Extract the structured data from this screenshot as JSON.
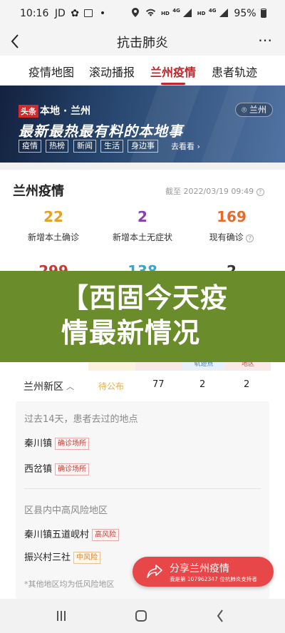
{
  "status_bar": {
    "time": "10:16",
    "carrier": "JD",
    "battery": "95%",
    "icons": [
      "paw-icon",
      "image-icon",
      "dot-icon",
      "location-icon",
      "wifi-icon",
      "signal-icon",
      "battery-icon"
    ],
    "hd1": "HD",
    "net1": "4G",
    "hd2": "HD",
    "net2": "4G"
  },
  "header": {
    "title": "抗击肺炎",
    "back_icon": "back-arrow-icon",
    "more_icon": "more-dots-icon"
  },
  "tabs": [
    {
      "label": "疫情地图",
      "active": false
    },
    {
      "label": "滚动播报",
      "active": false
    },
    {
      "label": "兰州疫情",
      "active": true
    },
    {
      "label": "患者轨迹",
      "active": false
    }
  ],
  "banner": {
    "badge": "头条",
    "channel": "本地 · 兰州",
    "headline": "最新最热最有料的本地事",
    "location_chip": "兰州",
    "chips": [
      "疫情",
      "热榜",
      "新闻",
      "生活",
      "身边事"
    ],
    "more_link": "去看看"
  },
  "summary": {
    "title": "兰州疫情",
    "updated": "截至 2022/03/19 09:49",
    "stats": [
      {
        "value": "22",
        "label": "新增本土确诊",
        "color": "#e8a020"
      },
      {
        "value": "2",
        "label": "新增本土无症状",
        "color": "#8a3fb0"
      },
      {
        "value": "169",
        "label": "现有确诊",
        "color": "#e86a2a"
      }
    ],
    "stats_row2_partial": [
      "299",
      "138",
      "2"
    ]
  },
  "overlay": {
    "title_line1": "【西固今天疫",
    "title_line2": "情最新情况"
  },
  "table": {
    "header_partial": [
      "轨迹点",
      "地区"
    ],
    "row": {
      "district": "兰州新区",
      "pending": "待公布",
      "c1": "77",
      "c2": "2",
      "c3": "2"
    }
  },
  "details": {
    "places_title": "过去14天，患者去过的地点",
    "places": [
      {
        "name": "秦川镇",
        "tag": "确诊场所"
      },
      {
        "name": "西岔镇",
        "tag": "确诊场所"
      }
    ],
    "risk_title": "区县内中高风险地区",
    "risk": [
      {
        "name": "秦川镇五道岘村",
        "tag": "高风险",
        "level": "high"
      },
      {
        "name": "振兴村三社",
        "tag": "中风险",
        "level": "medium"
      }
    ],
    "footnote": "*其他地区均为低风险地区"
  },
  "share": {
    "label": "分享兰州疫情",
    "sub": "我是第 107962347 位抗肺炎支持者",
    "icon": "share-arrow-icon"
  },
  "nav": {
    "icons": [
      "recent-apps-icon",
      "home-icon",
      "back-icon"
    ]
  }
}
